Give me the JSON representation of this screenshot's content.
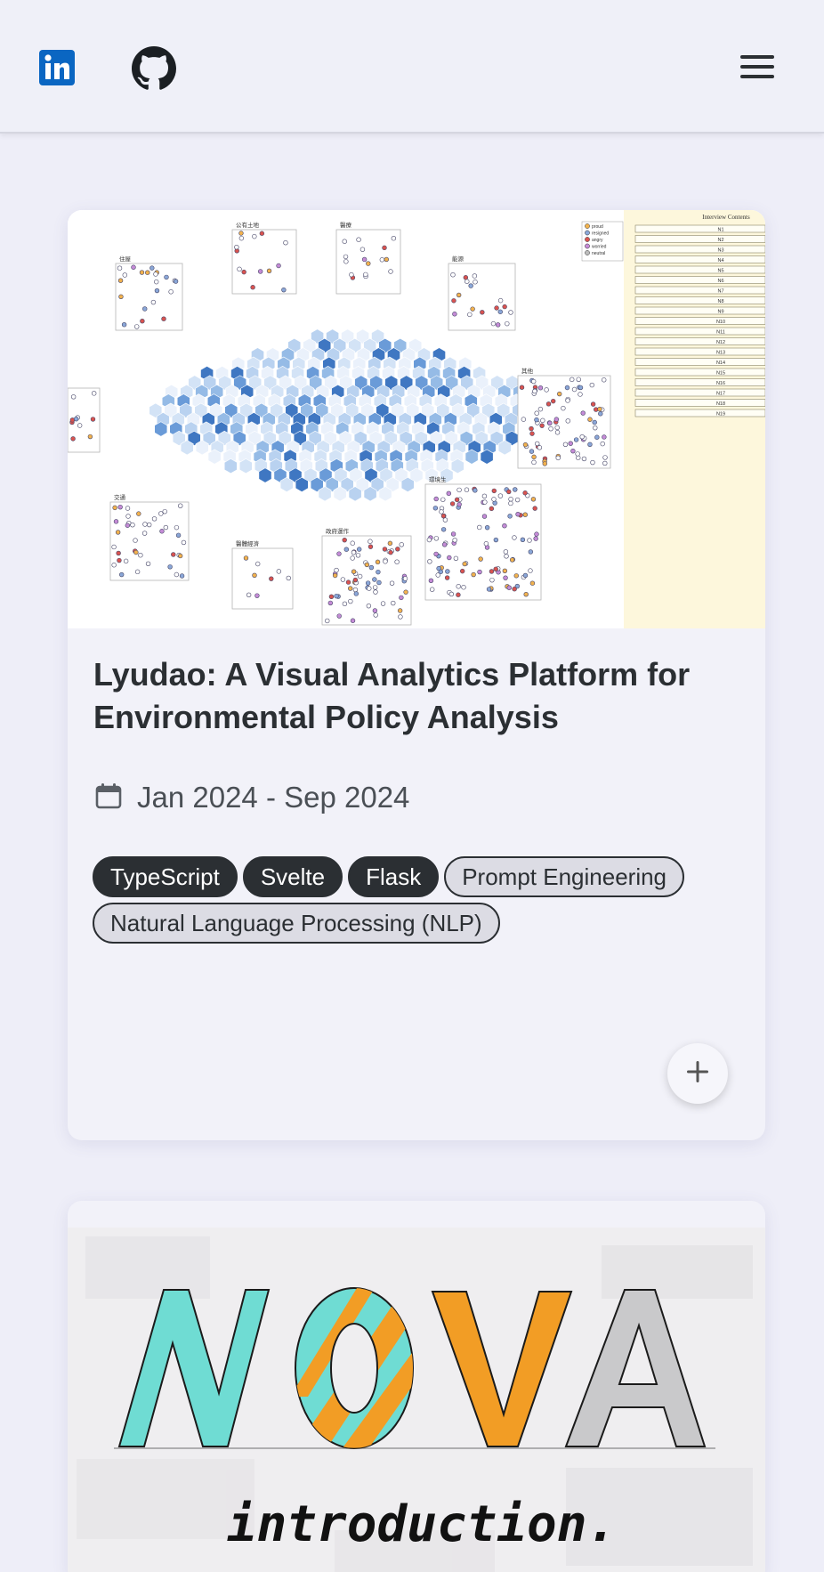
{
  "header": {
    "linkedin_icon": "linkedin-icon",
    "github_icon": "github-icon",
    "menu_icon": "hamburger-menu-icon"
  },
  "projects": [
    {
      "title": "Lyudao: A Visual Analytics Platform for Environmental Policy Analysis",
      "date": "Jan 2024 - Sep 2024",
      "date_icon": "calendar-icon",
      "tags": [
        {
          "label": "TypeScript",
          "style": "filled"
        },
        {
          "label": "Svelte",
          "style": "filled"
        },
        {
          "label": "Flask",
          "style": "filled"
        },
        {
          "label": "Prompt Engineering",
          "style": "outlined"
        },
        {
          "label": "Natural Language Processing (NLP)",
          "style": "outlined"
        }
      ],
      "expand_icon": "plus-icon",
      "thumbnail": {
        "panel_title": "Interview Contents",
        "legend": [
          "proud",
          "resigned",
          "angry",
          "worried",
          "neutral"
        ],
        "interview_rows": [
          "N1",
          "N2",
          "N3",
          "N4",
          "N5",
          "N6",
          "N7",
          "N8",
          "N9",
          "N10",
          "N11",
          "N12",
          "N13",
          "N14",
          "N15",
          "N16",
          "N17",
          "N18",
          "N19"
        ],
        "cluster_labels": [
          "公有土地",
          "醫療",
          "住屋",
          "能源",
          "其他",
          "環境生",
          "交通",
          "醫體經濟",
          "政府運作"
        ]
      }
    },
    {
      "thumbnail": {
        "logo_text": "NOVA",
        "subtitle": "introduction."
      }
    }
  ]
}
